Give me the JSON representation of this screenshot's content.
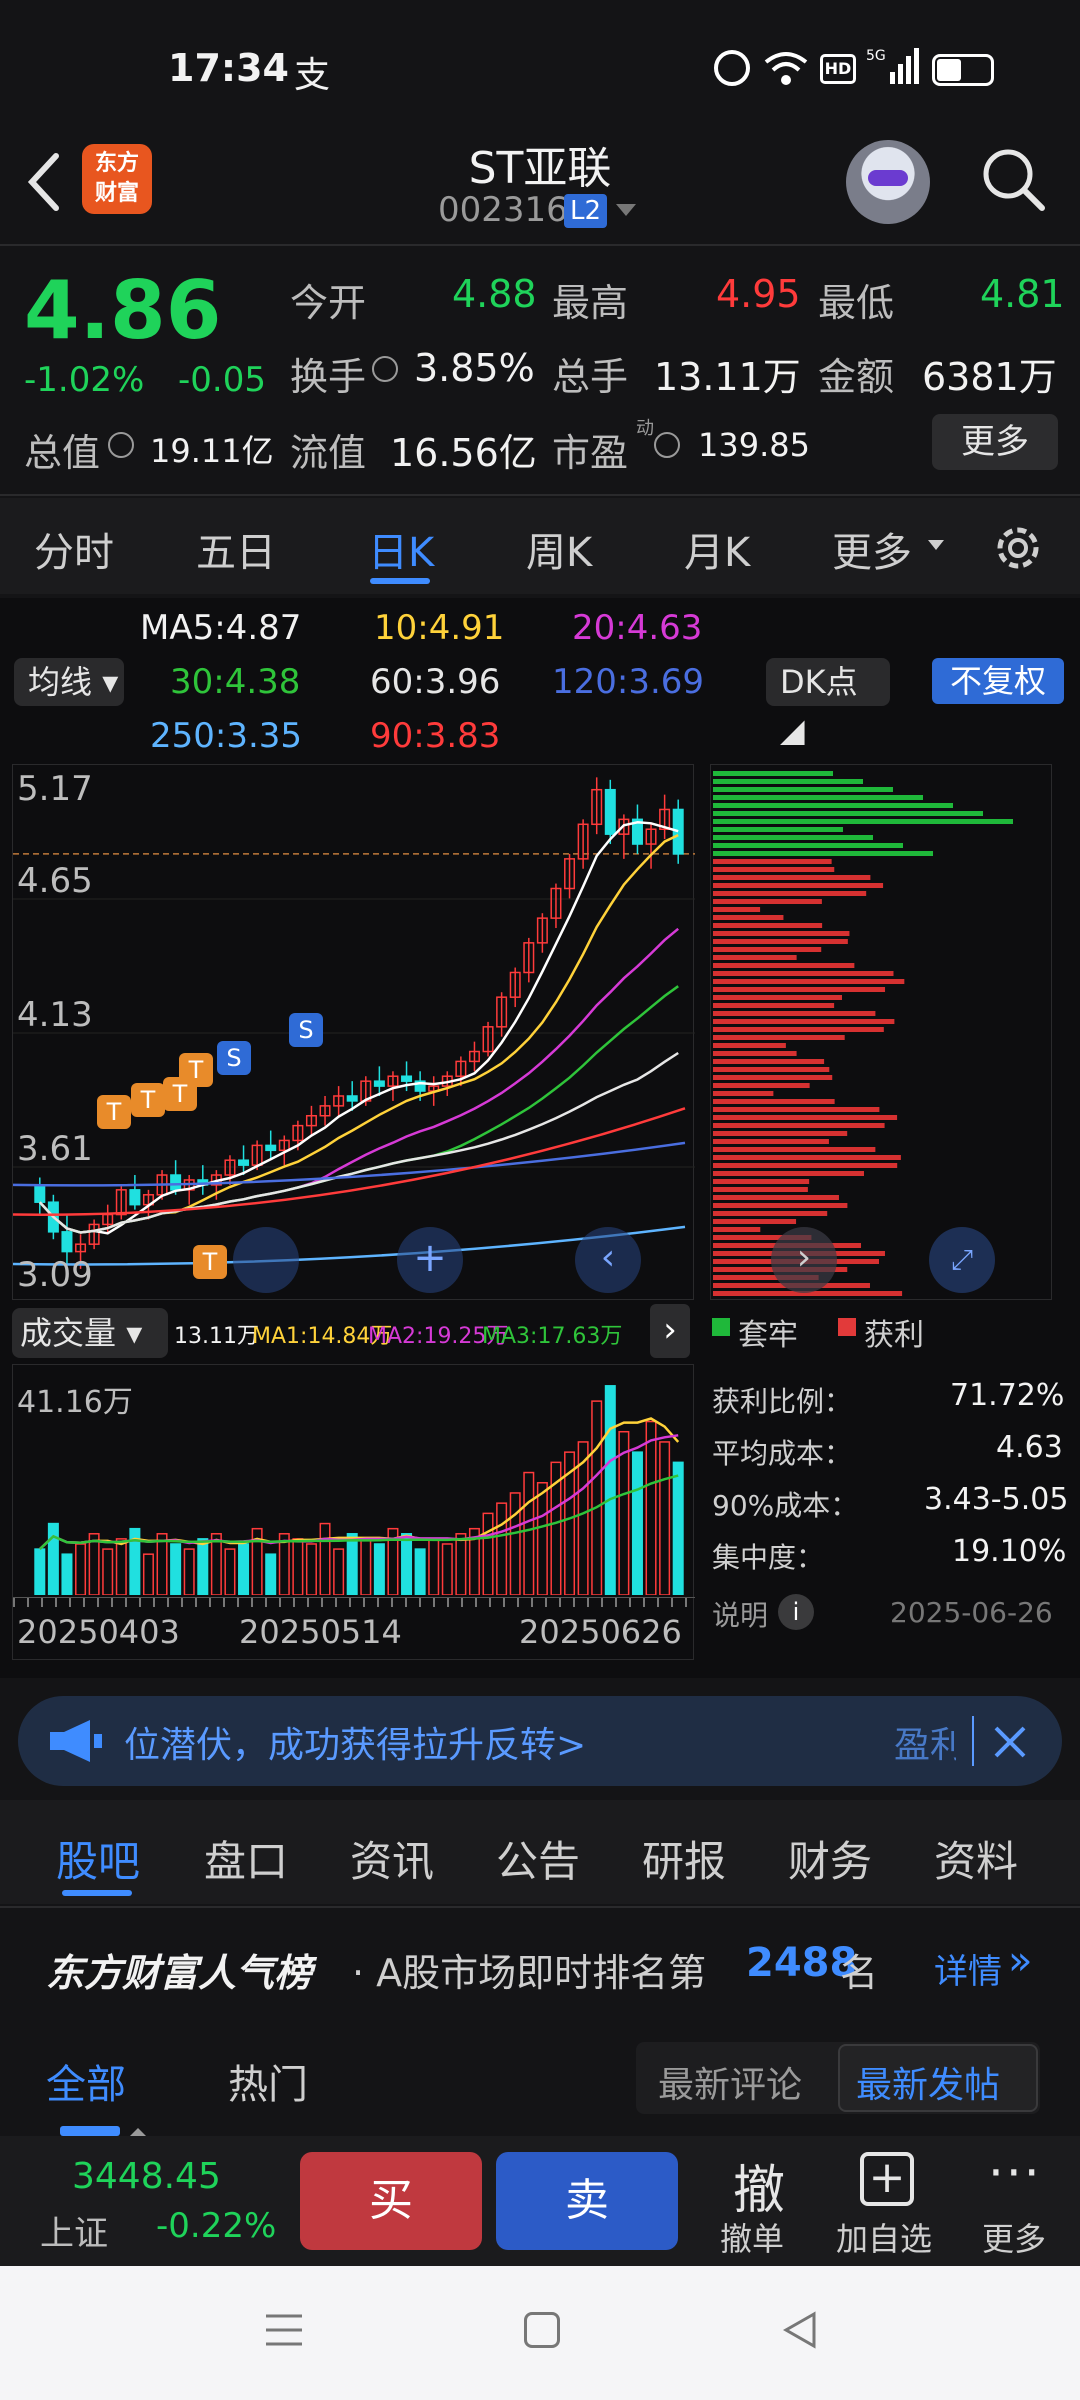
{
  "status": {
    "time": "17:34",
    "alipay_glyph": "支"
  },
  "header": {
    "logo_line1": "东方",
    "logo_line2": "财富",
    "stock_name": "ST亚联",
    "stock_code": "002316",
    "level_badge": "L2"
  },
  "quote": {
    "price": "4.86",
    "change_pct": "-1.02%",
    "change": "-0.05",
    "open_label": "今开",
    "open": "4.88",
    "high_label": "最高",
    "high": "4.95",
    "low_label": "最低",
    "low": "4.81",
    "turnover_label": "换手",
    "turnover": "3.85%",
    "volume_label": "总手",
    "volume": "13.11万",
    "amount_label": "金额",
    "amount": "6381万",
    "mktcap_label": "总值",
    "mktcap": "19.11亿",
    "float_label": "流值",
    "float": "16.56亿",
    "pe_label": "市盈",
    "pe_sup": "动",
    "pe": "139.85",
    "more": "更多"
  },
  "ktabs": [
    "分时",
    "五日",
    "日K",
    "周K",
    "月K",
    "更多"
  ],
  "ma": {
    "ma5": "MA5:4.87",
    "ma10": "10:4.91",
    "ma20": "20:4.63",
    "ma30": "30:4.38",
    "ma60": "60:3.96",
    "ma120": "120:3.69",
    "ma250": "250:3.35",
    "ma90": "90:3.83",
    "select_label": "均线",
    "dk_label": "DK点",
    "adj_label": "不复权"
  },
  "price_axis": [
    "5.17",
    "4.65",
    "4.13",
    "3.61",
    "3.09"
  ],
  "volume_panel": {
    "label": "成交量",
    "vol": "13.11万",
    "ma1": "MA1:14.84万",
    "ma2": "MA2:19.25万",
    "ma3": "MA3:17.63万",
    "max": "41.16万",
    "dates": [
      "20250403",
      "20250514",
      "20250626"
    ]
  },
  "chip": {
    "legend_trap": "套牢",
    "legend_profit": "获利",
    "profit_ratio_label": "获利比例：",
    "profit_ratio": "71.72%",
    "avg_cost_label": "平均成本：",
    "avg_cost": "4.63",
    "cost90_label": "90%成本：",
    "cost90": "3.43-5.05",
    "concentration_label": "集中度：",
    "concentration": "19.10%",
    "note_label": "说明",
    "date": "2025-06-26"
  },
  "banner": {
    "text": "位潜伏，成功获得拉升反转>",
    "tail": "盈利"
  },
  "section_tabs": [
    "股吧",
    "盘口",
    "资讯",
    "公告",
    "研报",
    "财务",
    "资料"
  ],
  "rank": {
    "brand": "东方财富人气榜",
    "text_pre": "· A股市场即时排名第",
    "rank": "2488",
    "text_post": "名",
    "detail": "详情"
  },
  "forum_tabs": {
    "all": "全部",
    "hot": "热门",
    "latest_comment": "最新评论",
    "latest_post": "最新发帖"
  },
  "bottom": {
    "index_val": "3448.45",
    "index_name": "上证",
    "index_chg": "-0.22%",
    "buy": "买",
    "sell": "卖",
    "cancel_icon": "撤",
    "cancel": "撤单",
    "add": "加自选",
    "more": "更多"
  },
  "chart_data": {
    "type": "candlestick",
    "title": "",
    "y_ticks": [
      5.17,
      4.65,
      4.13,
      3.61,
      3.09
    ],
    "x_ticks": [
      "20250403",
      "20250514",
      "20250626"
    ],
    "candles": [
      [
        3.52,
        3.55,
        3.4,
        3.45
      ],
      [
        3.45,
        3.48,
        3.3,
        3.33
      ],
      [
        3.33,
        3.4,
        3.2,
        3.25
      ],
      [
        3.25,
        3.32,
        3.18,
        3.28
      ],
      [
        3.28,
        3.38,
        3.26,
        3.36
      ],
      [
        3.36,
        3.44,
        3.32,
        3.4
      ],
      [
        3.4,
        3.52,
        3.38,
        3.5
      ],
      [
        3.5,
        3.56,
        3.42,
        3.44
      ],
      [
        3.44,
        3.5,
        3.38,
        3.48
      ],
      [
        3.48,
        3.58,
        3.46,
        3.56
      ],
      [
        3.56,
        3.62,
        3.48,
        3.5
      ],
      [
        3.5,
        3.56,
        3.44,
        3.54
      ],
      [
        3.54,
        3.6,
        3.48,
        3.52
      ],
      [
        3.52,
        3.58,
        3.46,
        3.56
      ],
      [
        3.56,
        3.64,
        3.52,
        3.62
      ],
      [
        3.62,
        3.68,
        3.56,
        3.6
      ],
      [
        3.6,
        3.7,
        3.58,
        3.68
      ],
      [
        3.68,
        3.74,
        3.62,
        3.66
      ],
      [
        3.66,
        3.72,
        3.6,
        3.7
      ],
      [
        3.7,
        3.78,
        3.66,
        3.76
      ],
      [
        3.76,
        3.84,
        3.72,
        3.8
      ],
      [
        3.8,
        3.88,
        3.76,
        3.84
      ],
      [
        3.84,
        3.92,
        3.8,
        3.88
      ],
      [
        3.88,
        3.94,
        3.82,
        3.86
      ],
      [
        3.86,
        3.96,
        3.84,
        3.94
      ],
      [
        3.94,
        4.0,
        3.88,
        3.92
      ],
      [
        3.92,
        3.98,
        3.86,
        3.96
      ],
      [
        3.96,
        4.02,
        3.9,
        3.94
      ],
      [
        3.94,
        3.98,
        3.86,
        3.9
      ],
      [
        3.9,
        3.96,
        3.84,
        3.92
      ],
      [
        3.92,
        3.98,
        3.88,
        3.96
      ],
      [
        3.96,
        4.04,
        3.92,
        4.02
      ],
      [
        4.02,
        4.1,
        3.98,
        4.06
      ],
      [
        4.06,
        4.18,
        4.04,
        4.16
      ],
      [
        4.16,
        4.3,
        4.12,
        4.28
      ],
      [
        4.28,
        4.4,
        4.24,
        4.38
      ],
      [
        4.38,
        4.52,
        4.34,
        4.5
      ],
      [
        4.5,
        4.62,
        4.46,
        4.6
      ],
      [
        4.6,
        4.74,
        4.56,
        4.72
      ],
      [
        4.72,
        4.86,
        4.68,
        4.84
      ],
      [
        4.84,
        5.0,
        4.8,
        4.98
      ],
      [
        4.98,
        5.17,
        4.94,
        5.12
      ],
      [
        5.12,
        5.16,
        4.9,
        4.94
      ],
      [
        4.94,
        5.02,
        4.84,
        5.0
      ],
      [
        5.0,
        5.06,
        4.86,
        4.9
      ],
      [
        4.9,
        4.98,
        4.8,
        4.96
      ],
      [
        4.96,
        5.1,
        4.92,
        5.04
      ],
      [
        5.04,
        5.08,
        4.82,
        4.86
      ]
    ],
    "volumes": [
      9,
      14,
      8,
      10,
      12,
      9,
      11,
      13,
      8,
      12,
      10,
      9,
      11,
      12,
      9,
      10,
      13,
      8,
      12,
      11,
      10,
      14,
      9,
      12,
      11,
      10,
      13,
      12,
      9,
      11,
      10,
      12,
      13,
      16,
      18,
      20,
      24,
      22,
      26,
      28,
      30,
      38,
      41,
      32,
      28,
      34,
      30,
      26
    ]
  }
}
